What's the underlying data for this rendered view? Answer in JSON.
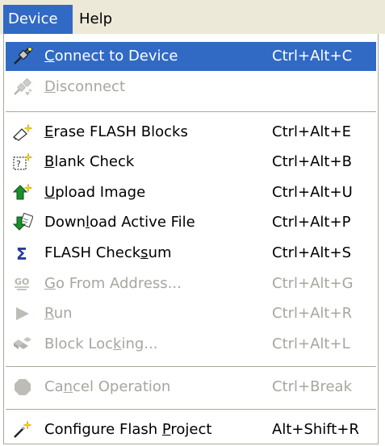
{
  "menubar": {
    "device": "Device",
    "help": "Help"
  },
  "menu": {
    "items": [
      {
        "pre": "",
        "key": "C",
        "post": "onnect to Device",
        "shortcut": "Ctrl+Alt+C",
        "icon": "plug-connect-icon",
        "enabled": true,
        "highlighted": true
      },
      {
        "pre": "",
        "key": "D",
        "post": "isconnect",
        "shortcut": "",
        "icon": "plug-disconnect-icon",
        "enabled": false
      },
      {
        "pre": "",
        "key": "E",
        "post": "rase FLASH Blocks",
        "shortcut": "Ctrl+Alt+E",
        "icon": "eraser-icon",
        "enabled": true
      },
      {
        "pre": "",
        "key": "B",
        "post": "lank Check",
        "shortcut": "Ctrl+Alt+B",
        "icon": "blank-check-icon",
        "enabled": true
      },
      {
        "pre": "",
        "key": "U",
        "post": "pload Image",
        "shortcut": "Ctrl+Alt+U",
        "icon": "upload-icon",
        "enabled": true
      },
      {
        "pre": "Down",
        "key": "l",
        "post": "oad Active File",
        "shortcut": "Ctrl+Alt+P",
        "icon": "download-icon",
        "enabled": true
      },
      {
        "pre": "FLASH Check",
        "key": "s",
        "post": "um",
        "shortcut": "Ctrl+Alt+S",
        "icon": "sigma-icon",
        "enabled": true
      },
      {
        "pre": "",
        "key": "G",
        "post": "o From Address...",
        "shortcut": "Ctrl+Alt+G",
        "icon": "go-icon",
        "enabled": false
      },
      {
        "pre": "",
        "key": "R",
        "post": "un",
        "shortcut": "Ctrl+Alt+R",
        "icon": "run-icon",
        "enabled": false
      },
      {
        "pre": "Block Loc",
        "key": "k",
        "post": "ing...",
        "shortcut": "Ctrl+Alt+L",
        "icon": "block-locking-icon",
        "enabled": false
      },
      {
        "pre": "Ca",
        "key": "n",
        "post": "cel Operation",
        "shortcut": "Ctrl+Break",
        "icon": "stop-icon",
        "enabled": false
      },
      {
        "pre": "Configure Flash ",
        "key": "P",
        "post": "roject",
        "shortcut": "Alt+Shift+R",
        "icon": "configure-wand-icon",
        "enabled": true
      }
    ]
  },
  "colors": {
    "highlight": "#316ac5",
    "disabled_text": "#a7a6a0",
    "menubar_bg": "#ece9d8"
  }
}
